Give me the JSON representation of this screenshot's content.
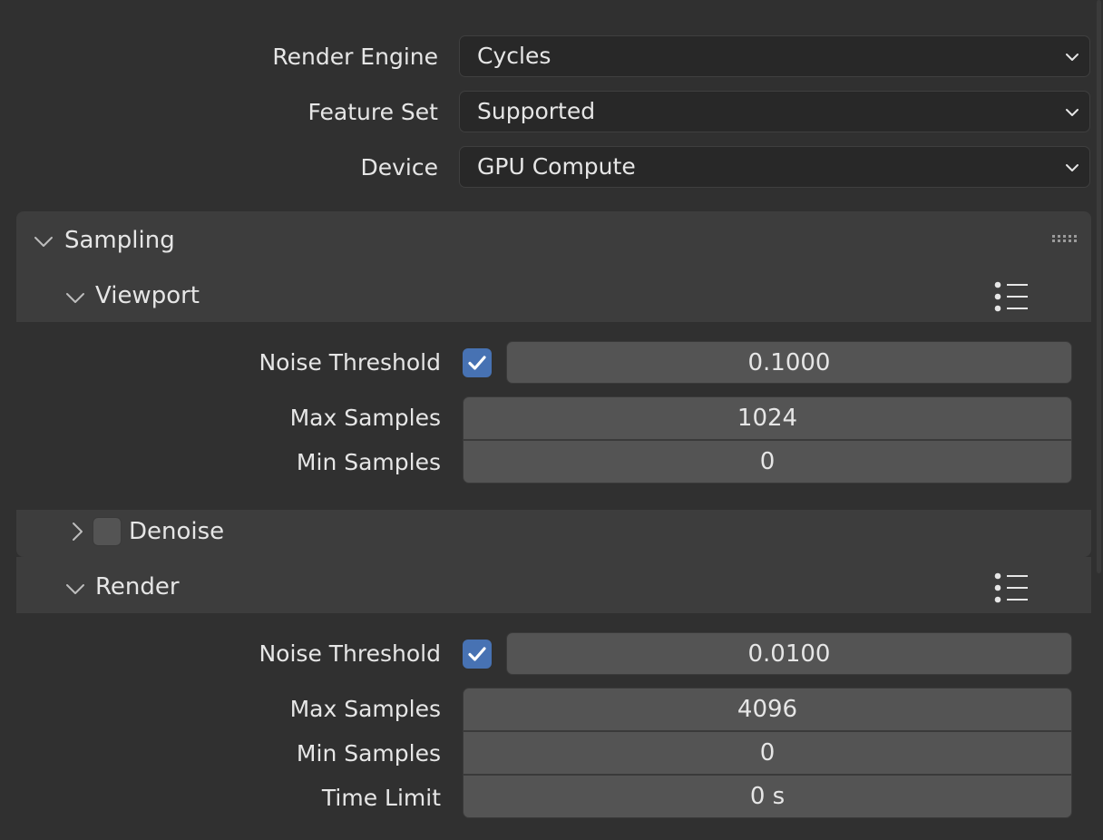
{
  "render": {
    "engine": {
      "label": "Render Engine",
      "value": "Cycles"
    },
    "feature_set": {
      "label": "Feature Set",
      "value": "Supported"
    },
    "device": {
      "label": "Device",
      "value": "GPU Compute"
    }
  },
  "sampling": {
    "title": "Sampling",
    "viewport": {
      "title": "Viewport",
      "noise_threshold": {
        "label": "Noise Threshold",
        "enabled": true,
        "value": "0.1000"
      },
      "max_samples": {
        "label": "Max Samples",
        "value": "1024"
      },
      "min_samples": {
        "label": "Min Samples",
        "value": "0"
      },
      "denoise": {
        "label": "Denoise",
        "enabled": false
      }
    },
    "render": {
      "title": "Render",
      "noise_threshold": {
        "label": "Noise Threshold",
        "enabled": true,
        "value": "0.0100"
      },
      "max_samples": {
        "label": "Max Samples",
        "value": "4096"
      },
      "min_samples": {
        "label": "Min Samples",
        "value": "0"
      },
      "time_limit": {
        "label": "Time Limit",
        "value": "0 s"
      }
    }
  },
  "icons": {
    "dropdown": "chevron-down-icon",
    "expanded": "chevron-down-icon",
    "collapsed": "chevron-right-icon",
    "presets": "preset-list-icon",
    "drag": "drag-handle-icon",
    "check": "checkmark-icon"
  },
  "colors": {
    "background": "#303030",
    "panel": "#3d3d3d",
    "field": "#545454",
    "dropdown": "#282828",
    "checkbox_on": "#4772b3",
    "text": "#e6e6e6"
  }
}
